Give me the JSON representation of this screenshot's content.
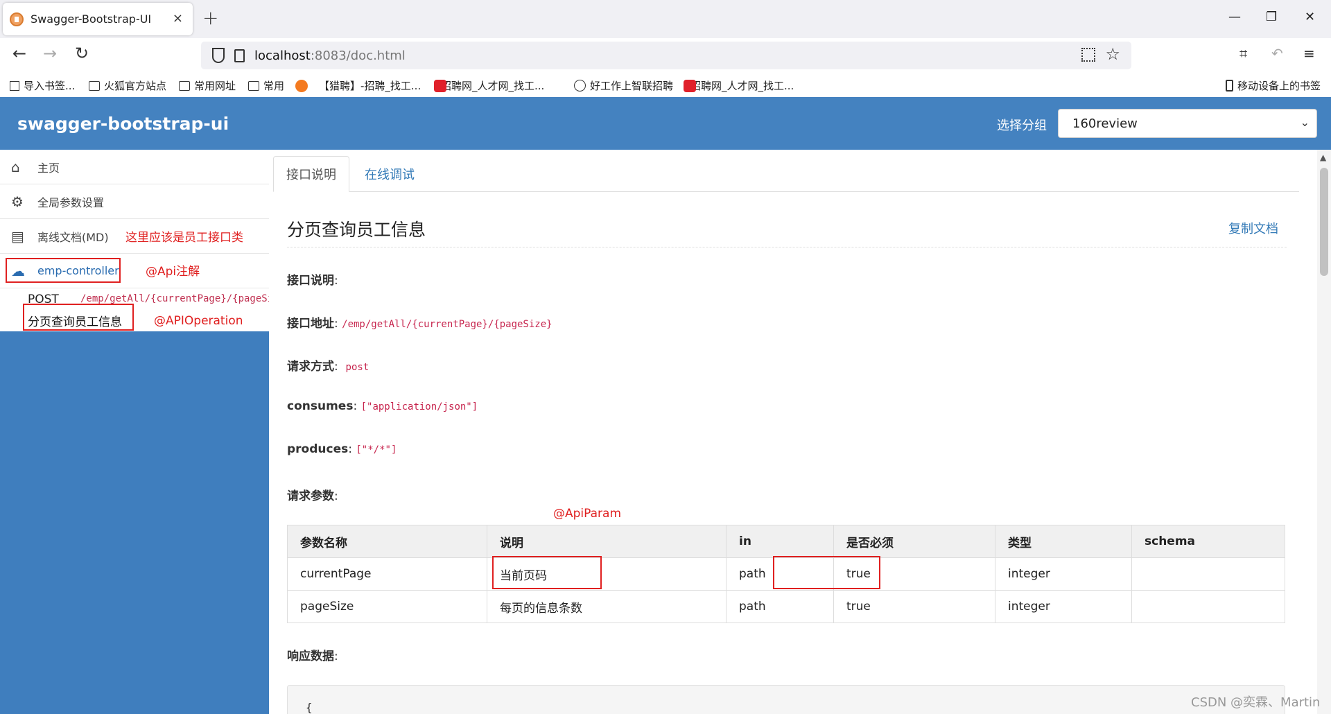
{
  "browser": {
    "tab_title": "Swagger-Bootstrap-UI",
    "tab_close": "×",
    "new_tab": "+",
    "url_host": "localhost",
    "url_rest": ":8083/doc.html",
    "win_min": "—",
    "win_restore": "❐",
    "win_close": "✕",
    "bookmarks": [
      {
        "label": "导入书签...",
        "icon": "import-icon"
      },
      {
        "label": "火狐官方站点",
        "icon": "folder-icon"
      },
      {
        "label": "常用网址",
        "icon": "folder-icon"
      },
      {
        "label": "常用",
        "icon": "folder-icon"
      },
      {
        "label": "【猎聘】-招聘_找工...",
        "icon": "liepin-icon"
      },
      {
        "label": "招聘网_人才网_找工...",
        "icon": "zhaopin-icon"
      },
      {
        "label": "好工作上智联招聘",
        "icon": "globe-icon"
      },
      {
        "label": "招聘网_人才网_找工...",
        "icon": "zhaopin-icon"
      }
    ],
    "mobile_bookmarks": "移动设备上的书签"
  },
  "header": {
    "title": "swagger-bootstrap-ui",
    "group_label": "选择分组",
    "group_value": "160review",
    "accent": "#4482c0"
  },
  "sidebar": {
    "home": "主页",
    "global_params": "全局参数设置",
    "offline_docs": "离线文档(MD)",
    "controller": "emp-controller",
    "api": {
      "method": "POST",
      "path": "/emp/getAll/{currentPage}/{pageSize}",
      "summary": "分页查询员工信息"
    }
  },
  "annotations": {
    "controller_note": "这里应该是员工接口类",
    "api_note": "@Api注解",
    "operation_note": "@APIOperation",
    "param_note": "@ApiParam"
  },
  "main": {
    "tabs": [
      "接口说明",
      "在线调试"
    ],
    "title": "分页查询员工信息",
    "copy_doc": "复制文档",
    "desc_label": "接口说明",
    "addr_label": "接口地址",
    "addr_value": "/emp/getAll/{currentPage}/{pageSize}",
    "method_label": "请求方式",
    "method_value": "post",
    "consumes_label": "consumes",
    "consumes_value": "[\"application/json\"]",
    "produces_label": "produces",
    "produces_value": "[\"*/*\"]",
    "params_label": "请求参数",
    "params_headers": [
      "参数名称",
      "说明",
      "in",
      "是否必须",
      "类型",
      "schema"
    ],
    "params_rows": [
      [
        "currentPage",
        "当前页码",
        "path",
        "true",
        "integer",
        ""
      ],
      [
        "pageSize",
        "每页的信息条数",
        "path",
        "true",
        "integer",
        ""
      ]
    ],
    "response_label": "响应数据",
    "response_preview": "{"
  },
  "watermark": "CSDN @奕霖、Martin"
}
